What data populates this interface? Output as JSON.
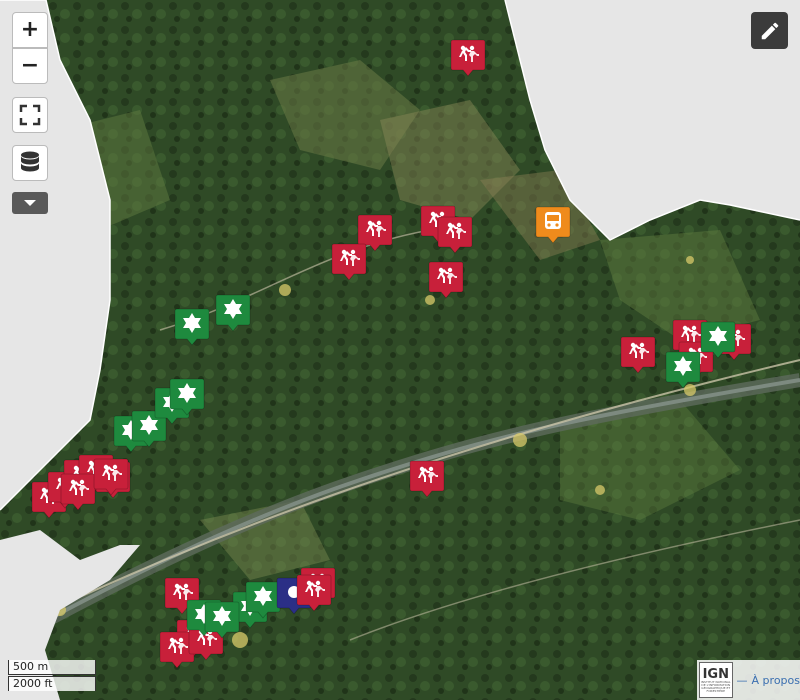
{
  "controls": {
    "zoom_in_label": "+",
    "zoom_out_label": "−",
    "fullscreen_icon": "fullscreen-icon",
    "layers_icon": "layers-icon",
    "more_icon": "caret-down-icon",
    "edit_icon": "pencil-icon"
  },
  "scale": {
    "metric": "500 m",
    "imperial": "2000 ft"
  },
  "attribution": {
    "logo_text": "IGN",
    "logo_subtext": "INSTITUT NATIONAL DE L'INFORMATION GÉOGRAPHIQUE ET FORESTIÈRE",
    "about_link": "À propos",
    "about_prefix": "—"
  },
  "colors": {
    "hiking_marker": "#c8203a",
    "viewpoint_marker": "#1e8a3e",
    "bus_marker": "#ef8b1c",
    "poi_marker": "#2b2f86",
    "outside_area": "#e6e6e6"
  },
  "markers": [
    {
      "type": "hiking",
      "icon": "hiking-icon"
    },
    {
      "type": "hiking",
      "icon": "hiking-icon"
    },
    {
      "type": "hiking",
      "icon": "hiking-icon"
    },
    {
      "type": "hiking",
      "icon": "hiking-icon"
    },
    {
      "type": "hiking",
      "icon": "hiking-icon"
    },
    {
      "type": "hiking",
      "icon": "hiking-icon"
    },
    {
      "type": "hiking",
      "icon": "hiking-icon"
    },
    {
      "type": "bus",
      "icon": "bus-icon"
    },
    {
      "type": "viewpoint",
      "icon": "star-icon"
    },
    {
      "type": "viewpoint",
      "icon": "star-icon"
    },
    {
      "type": "viewpoint",
      "icon": "star-icon"
    },
    {
      "type": "viewpoint",
      "icon": "star-icon"
    },
    {
      "type": "viewpoint",
      "icon": "star-icon"
    },
    {
      "type": "viewpoint",
      "icon": "star-icon"
    },
    {
      "type": "hiking",
      "icon": "hiking-icon"
    },
    {
      "type": "hiking",
      "icon": "hiking-icon"
    },
    {
      "type": "hiking",
      "icon": "hiking-icon"
    },
    {
      "type": "hiking",
      "icon": "hiking-icon"
    },
    {
      "type": "hiking",
      "icon": "hiking-icon"
    },
    {
      "type": "hiking",
      "icon": "hiking-icon"
    },
    {
      "type": "hiking",
      "icon": "hiking-icon"
    },
    {
      "type": "hiking",
      "icon": "hiking-icon"
    },
    {
      "type": "hiking",
      "icon": "hiking-icon"
    },
    {
      "type": "viewpoint",
      "icon": "star-icon"
    },
    {
      "type": "viewpoint",
      "icon": "star-icon"
    },
    {
      "type": "hiking",
      "icon": "hiking-icon"
    },
    {
      "type": "hiking",
      "icon": "hiking-icon"
    },
    {
      "type": "hiking",
      "icon": "hiking-icon"
    },
    {
      "type": "hiking",
      "icon": "hiking-icon"
    },
    {
      "type": "viewpoint",
      "icon": "star-icon"
    },
    {
      "type": "viewpoint",
      "icon": "star-icon"
    },
    {
      "type": "viewpoint",
      "icon": "star-icon"
    },
    {
      "type": "viewpoint",
      "icon": "star-icon"
    },
    {
      "type": "poi",
      "icon": "dot-icon"
    },
    {
      "type": "hiking",
      "icon": "hiking-icon"
    },
    {
      "type": "hiking",
      "icon": "hiking-icon"
    },
    {
      "type": "hiking",
      "icon": "hiking-icon"
    },
    {
      "type": "hiking",
      "icon": "hiking-icon"
    }
  ]
}
